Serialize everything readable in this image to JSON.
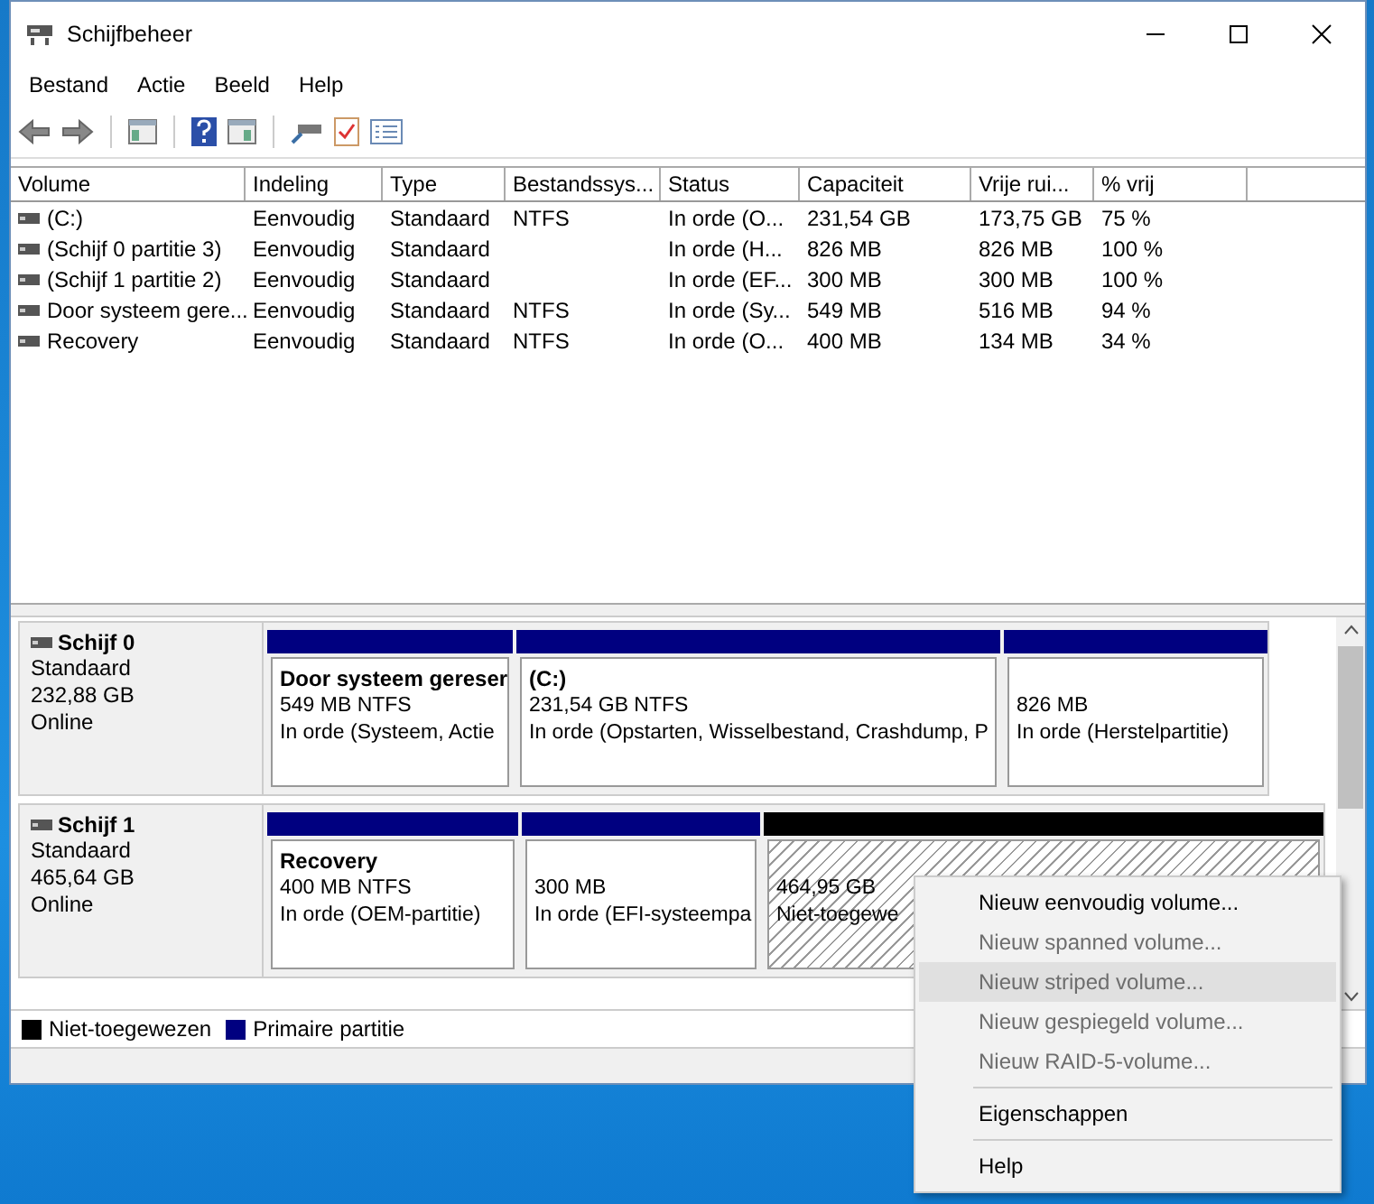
{
  "window": {
    "title": "Schijfbeheer"
  },
  "menu": [
    "Bestand",
    "Actie",
    "Beeld",
    "Help"
  ],
  "volumes": {
    "columns": [
      "Volume",
      "Indeling",
      "Type",
      "Bestandssys...",
      "Status",
      "Capaciteit",
      "Vrije rui...",
      "% vrij"
    ],
    "rows": [
      [
        "(C:)",
        "Eenvoudig",
        "Standaard",
        "NTFS",
        "In orde (O...",
        "231,54 GB",
        "173,75 GB",
        "75 %"
      ],
      [
        "(Schijf 0 partitie 3)",
        "Eenvoudig",
        "Standaard",
        "",
        "In orde (H...",
        "826 MB",
        "826 MB",
        "100 %"
      ],
      [
        "(Schijf 1 partitie 2)",
        "Eenvoudig",
        "Standaard",
        "",
        "In orde (EF...",
        "300 MB",
        "300 MB",
        "100 %"
      ],
      [
        "Door systeem gere...",
        "Eenvoudig",
        "Standaard",
        "NTFS",
        "In orde (Sy...",
        "549 MB",
        "516 MB",
        "94 %"
      ],
      [
        "Recovery",
        "Eenvoudig",
        "Standaard",
        "NTFS",
        "In orde (O...",
        "400 MB",
        "134 MB",
        "34 %"
      ]
    ]
  },
  "disks": [
    {
      "name": "Schijf 0",
      "type": "Standaard",
      "size": "232,88 GB",
      "status": "Online",
      "partitions": [
        {
          "kind": "primary",
          "name": "Door systeem gereser",
          "size": "549 MB NTFS",
          "status": "In orde (Systeem, Actie"
        },
        {
          "kind": "primary",
          "name": "(C:)",
          "size": "231,54 GB NTFS",
          "status": "In orde (Opstarten, Wisselbestand, Crashdump, P"
        },
        {
          "kind": "primary",
          "size": "826 MB",
          "status": "In orde (Herstelpartitie)"
        }
      ]
    },
    {
      "name": "Schijf 1",
      "type": "Standaard",
      "size": "465,64 GB",
      "status": "Online",
      "partitions": [
        {
          "kind": "primary",
          "name": "Recovery",
          "size": "400 MB NTFS",
          "status": "In orde (OEM-partitie)"
        },
        {
          "kind": "primary",
          "size": "300 MB",
          "status": "In orde (EFI-systeempa"
        },
        {
          "kind": "unallocated",
          "size": "464,95 GB",
          "status": "Niet-toegewe"
        }
      ]
    }
  ],
  "legend": [
    {
      "label": "Niet-toegewezen",
      "color": "#000000"
    },
    {
      "label": "Primaire partitie",
      "color": "#000080"
    }
  ],
  "context_menu": [
    {
      "kind": "item",
      "label": "Nieuw eenvoudig volume...",
      "disabled": false,
      "selected": false
    },
    {
      "kind": "item",
      "label": "Nieuw spanned volume...",
      "disabled": true,
      "selected": false
    },
    {
      "kind": "item",
      "label": "Nieuw striped volume...",
      "disabled": true,
      "selected": true
    },
    {
      "kind": "item",
      "label": "Nieuw gespiegeld volume...",
      "disabled": true,
      "selected": false
    },
    {
      "kind": "item",
      "label": "Nieuw RAID-5-volume...",
      "disabled": true,
      "selected": false
    },
    {
      "kind": "separator"
    },
    {
      "kind": "item",
      "label": "Eigenschappen",
      "disabled": false,
      "selected": false
    },
    {
      "kind": "separator"
    },
    {
      "kind": "item",
      "label": "Help",
      "disabled": false,
      "selected": false
    }
  ]
}
